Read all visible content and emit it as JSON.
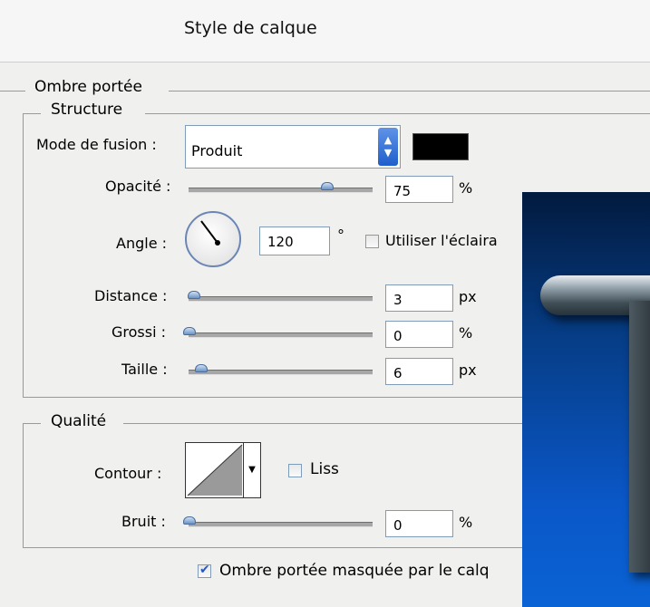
{
  "window": {
    "title": "Style de calque"
  },
  "drop_shadow": {
    "section_title": "Ombre portée",
    "structure": {
      "group_title": "Structure",
      "blend_mode": {
        "label": "Mode de fusion :",
        "value": "Produit",
        "color": "#000000"
      },
      "opacity": {
        "label": "Opacité :",
        "value": "75",
        "unit": "%",
        "slider_fraction": 0.75
      },
      "angle": {
        "label": "Angle :",
        "value": "120",
        "unit": "°",
        "global_light_label": "Utiliser l'éclaira",
        "global_light_checked": false
      },
      "distance": {
        "label": "Distance :",
        "value": "3",
        "unit": "px",
        "slider_fraction": 0.0
      },
      "spread": {
        "label": "Grossi :",
        "value": "0",
        "unit": "%",
        "slider_fraction": 0.0
      },
      "size": {
        "label": "Taille :",
        "value": "6",
        "unit": "px",
        "slider_fraction": 0.04
      }
    },
    "quality": {
      "group_title": "Qualité",
      "contour": {
        "label": "Contour :",
        "antialias_label": "Liss",
        "antialias_checked": false
      },
      "noise": {
        "label": "Bruit :",
        "value": "0",
        "unit": "%",
        "slider_fraction": 0.0
      }
    },
    "knockout": {
      "label": "Ombre portée masquée par le calq",
      "checked": true
    }
  },
  "colors": {
    "preview_bg": "#0a57c8",
    "accent": "#2a59b8"
  }
}
